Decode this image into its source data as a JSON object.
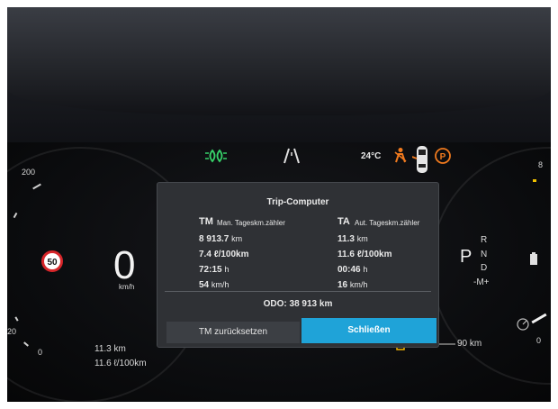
{
  "status_bar": {
    "outside_temp": "24°C"
  },
  "speedometer": {
    "scale_label_200": "200",
    "scale_label_20": "20",
    "scale_label_0": "0",
    "speed_value": "0",
    "speed_unit": "km/h",
    "speed_limit": "50"
  },
  "bottom_left": {
    "distance": "11.3 km",
    "consumption": "11.6 ℓ/100km"
  },
  "right_gauge": {
    "scale_label_8": "8",
    "scale_label_0": "0",
    "gear_current": "P",
    "gear_r": "R",
    "gear_n": "N",
    "gear_d": "D",
    "manual_mode": "-M+",
    "range": "90 km"
  },
  "trip_computer": {
    "title": "Trip-Computer",
    "tm": {
      "code": "TM",
      "label": "Man. Tageskm.zähler",
      "distance": "8 913.7",
      "distance_unit": "km",
      "consumption": "7.4 ℓ/100km",
      "time": "72:15",
      "time_unit": "h",
      "speed": "54",
      "speed_unit": "km/h"
    },
    "ta": {
      "code": "TA",
      "label": "Aut. Tageskm.zähler",
      "distance": "11.3",
      "distance_unit": "km",
      "consumption": "11.6 ℓ/100km",
      "time": "00:46",
      "time_unit": "h",
      "speed": "16",
      "speed_unit": "km/h"
    },
    "odo": "ODO: 38 913 km",
    "reset_button": "TM zurücksetzen",
    "close_button": "Schließen"
  },
  "colors": {
    "accent": "#1fa3d8",
    "headlight_green": "#37d36a",
    "warning_orange": "#f07a1e"
  },
  "icons": [
    "low-beam-icon",
    "lane-assist-icon",
    "seatbelt-warning-icon",
    "car-door-icon",
    "parking-brake-icon",
    "fuel-icon",
    "gear-shift-icon",
    "battery-icon",
    "drive-mode-icon"
  ]
}
